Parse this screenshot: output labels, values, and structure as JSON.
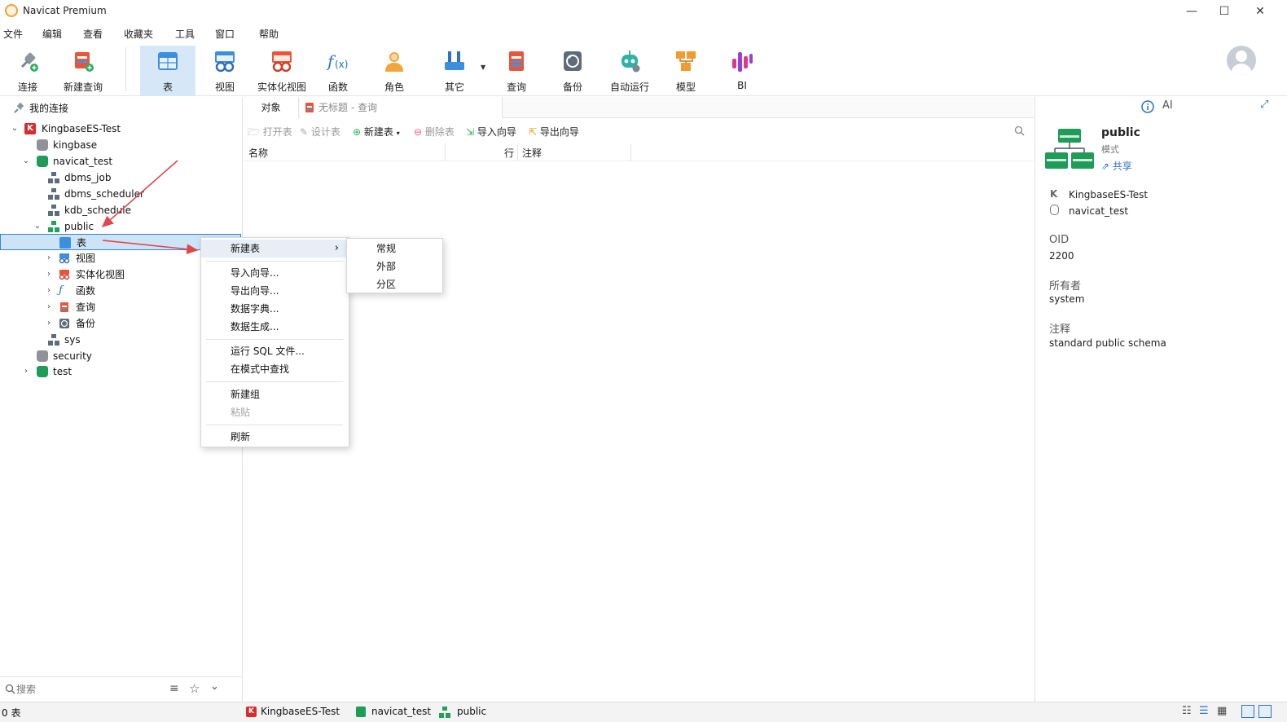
{
  "window": {
    "title": "Navicat Premium",
    "minimize": "—",
    "maximize": "☐",
    "close": "✕"
  },
  "menu": [
    "文件",
    "编辑",
    "查看",
    "收藏夹",
    "工具",
    "窗口",
    "帮助"
  ],
  "toolbar": [
    {
      "label": "连接",
      "icon": "plug-icon"
    },
    {
      "label": "新建查询",
      "icon": "new-query-icon"
    },
    {
      "label": "表",
      "icon": "table-icon",
      "active": true
    },
    {
      "label": "视图",
      "icon": "view-icon"
    },
    {
      "label": "实体化视图",
      "icon": "materialized-view-icon"
    },
    {
      "label": "函数",
      "icon": "function-icon"
    },
    {
      "label": "角色",
      "icon": "role-icon"
    },
    {
      "label": "其它",
      "icon": "tools-icon"
    },
    {
      "label": "查询",
      "icon": "query-icon"
    },
    {
      "label": "备份",
      "icon": "backup-icon"
    },
    {
      "label": "自动运行",
      "icon": "robot-icon"
    },
    {
      "label": "模型",
      "icon": "model-icon"
    },
    {
      "label": "BI",
      "icon": "bi-icon"
    }
  ],
  "tree": {
    "root": "我的连接",
    "connection": "KingbaseES-Test",
    "db_kingbase": "kingbase",
    "db_navicat": "navicat_test",
    "schema_dbms_job": "dbms_job",
    "schema_dbms_scheduler": "dbms_scheduler",
    "schema_kdb_schedule": "kdb_schedule",
    "schema_public": "public",
    "node_table": "表",
    "node_view": "视图",
    "node_mview": "实体化视图",
    "node_function": "函数",
    "node_query": "查询",
    "node_backup": "备份",
    "schema_sys": "sys",
    "db_security": "security",
    "db_test": "test"
  },
  "search": {
    "placeholder": "搜索"
  },
  "tabs": {
    "objects": "对象",
    "query": "无标题 - 查询"
  },
  "object_toolbar": {
    "open": "打开表",
    "design": "设计表",
    "new": "新建表",
    "delete": "删除表",
    "import": "导入向导",
    "export": "导出向导"
  },
  "columns": {
    "name": "名称",
    "rows": "行",
    "comment": "注释"
  },
  "context_menu": {
    "new_table": "新建表",
    "import": "导入向导...",
    "export": "导出向导...",
    "dict": "数据字典...",
    "generate": "数据生成...",
    "run_sql": "运行 SQL 文件...",
    "find": "在模式中查找",
    "new_group": "新建组",
    "paste": "粘贴",
    "refresh": "刷新"
  },
  "submenu": {
    "normal": "常规",
    "foreign": "外部",
    "partition": "分区"
  },
  "info": {
    "title": "public",
    "subtitle": "模式",
    "share": "共享",
    "ai": "AI",
    "connection": "KingbaseES-Test",
    "database": "navicat_test",
    "oid_label": "OID",
    "oid": "2200",
    "owner_label": "所有者",
    "owner": "system",
    "comment_label": "注释",
    "comment": "standard public schema"
  },
  "status": {
    "count": "0 表",
    "connection": "KingbaseES-Test",
    "database": "navicat_test",
    "schema": "public"
  },
  "colors": {
    "accent": "#3b82d6",
    "selected_bg": "#cde4f7",
    "annotation_arrow": "#e0474c",
    "db_green": "#1f9c58"
  }
}
